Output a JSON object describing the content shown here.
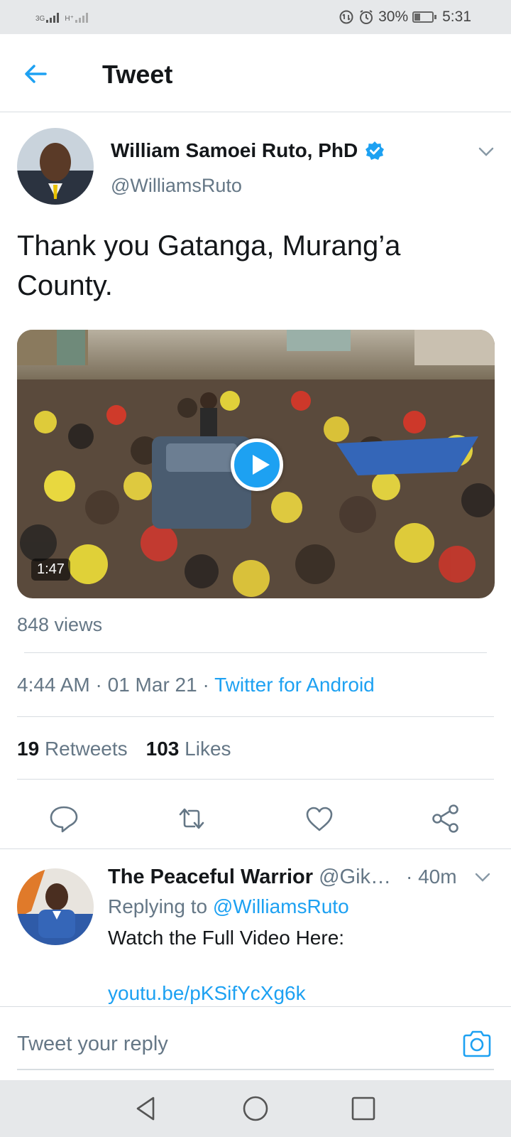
{
  "status_bar": {
    "net1": "3G",
    "net2": "H⁺",
    "battery": "30%",
    "battery_level": 0.3,
    "time": "5:31",
    "icons": [
      "data-saver-icon",
      "alarm-icon",
      "battery-icon"
    ]
  },
  "header": {
    "title": "Tweet",
    "back_icon": "back-arrow-icon"
  },
  "tweet": {
    "author_name": "William Samoei Ruto, PhD",
    "verified": true,
    "handle": "@WilliamsRuto",
    "text": "Thank you Gatanga, Murang’a County.",
    "video_duration": "1:47",
    "views": "848 views",
    "time": "4:44 AM",
    "date": "01 Mar 21",
    "source": "Twitter for Android",
    "retweets_count": "19",
    "retweets_label": "Retweets",
    "likes_count": "103",
    "likes_label": "Likes",
    "actions": [
      "reply-icon",
      "retweet-icon",
      "like-icon",
      "share-icon"
    ]
  },
  "reply": {
    "author_name": "The Peaceful Warrior",
    "handle": "@Gik…",
    "time": "· 40m",
    "replying_prefix": "Replying to",
    "replying_to": "@WilliamsRuto",
    "text": "Watch the Full Video Here:",
    "link": "youtu.be/pKSifYcXg6k"
  },
  "composer": {
    "placeholder": "Tweet your reply",
    "icon": "camera-icon"
  },
  "colors": {
    "accent": "#1DA1F2",
    "text_primary": "#14171A",
    "text_secondary": "#657786",
    "divider": "#D8DDE1"
  }
}
